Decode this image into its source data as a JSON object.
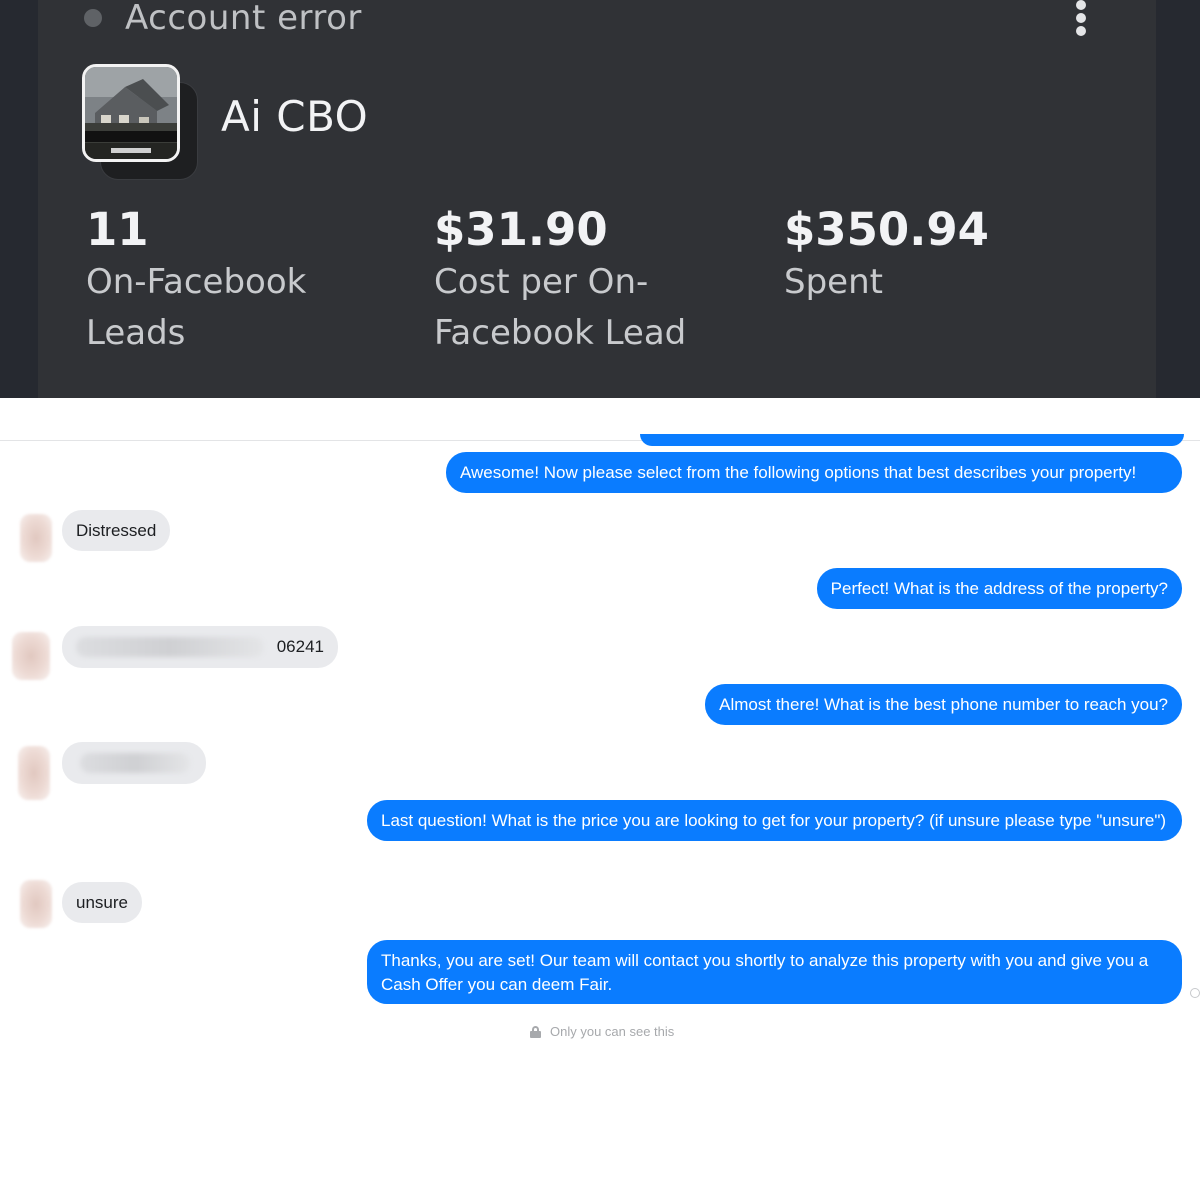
{
  "ad_card": {
    "status": "Account error",
    "campaign_name": "Ai CBO",
    "thumbnail_banner": "1-2 WEEK HOME SALE",
    "metrics": [
      {
        "value": "11",
        "label": "On-Facebook Leads"
      },
      {
        "value": "$31.90",
        "label": "Cost per On-Facebook Lead"
      },
      {
        "value": "$350.94",
        "label": "Spent"
      }
    ],
    "colors": {
      "card_bg": "#303236",
      "outer_bg": "#262930",
      "text": "#f2f3f5"
    }
  },
  "chat": {
    "messages": [
      {
        "from": "page",
        "text": "Awesome! Now please select from the following options that best describes your property!"
      },
      {
        "from": "user",
        "text": "Distressed"
      },
      {
        "from": "page",
        "text": "Perfect! What is the address of the property?"
      },
      {
        "from": "user",
        "text": "06241"
      },
      {
        "from": "page",
        "text": "Almost there! What is the best phone number to reach you?"
      },
      {
        "from": "user",
        "text": ""
      },
      {
        "from": "page",
        "text": "Last question! What is the price you are looking to get for your property? (if unsure please type \"unsure\")"
      },
      {
        "from": "user",
        "text": "unsure"
      },
      {
        "from": "page",
        "text": "Thanks, you are set! Our team will contact you shortly to analyze this property with you and give you a Cash Offer you can deem Fair."
      }
    ],
    "footer_note": "Only you can see this",
    "colors": {
      "outgoing": "#0a7cff",
      "incoming": "#e9eaed"
    }
  }
}
